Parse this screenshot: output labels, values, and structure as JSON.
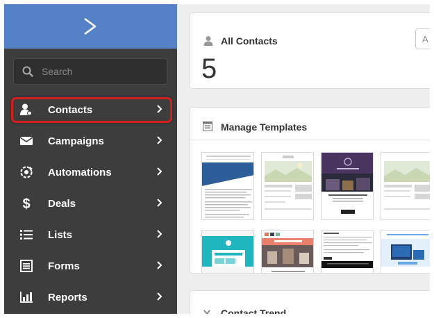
{
  "sidebar": {
    "search_placeholder": "Search",
    "items": [
      {
        "label": "Contacts",
        "icon": "contacts-icon"
      },
      {
        "label": "Campaigns",
        "icon": "envelope-icon"
      },
      {
        "label": "Automations",
        "icon": "automation-gear-icon"
      },
      {
        "label": "Deals",
        "icon": "dollar-icon"
      },
      {
        "label": "Lists",
        "icon": "list-icon"
      },
      {
        "label": "Forms",
        "icon": "form-icon"
      },
      {
        "label": "Reports",
        "icon": "bar-chart-icon"
      }
    ]
  },
  "main": {
    "contacts_card": {
      "title": "All Contacts",
      "count": "5",
      "button_text": "A"
    },
    "templates_card": {
      "title": "Manage Templates"
    },
    "trend_card": {
      "title": "Contact Trend"
    }
  },
  "colors": {
    "sidebar_bg": "#3d3d3d",
    "brand_bar": "#5582c7",
    "highlight": "#d51f1f",
    "main_bg": "#eeeeee"
  }
}
